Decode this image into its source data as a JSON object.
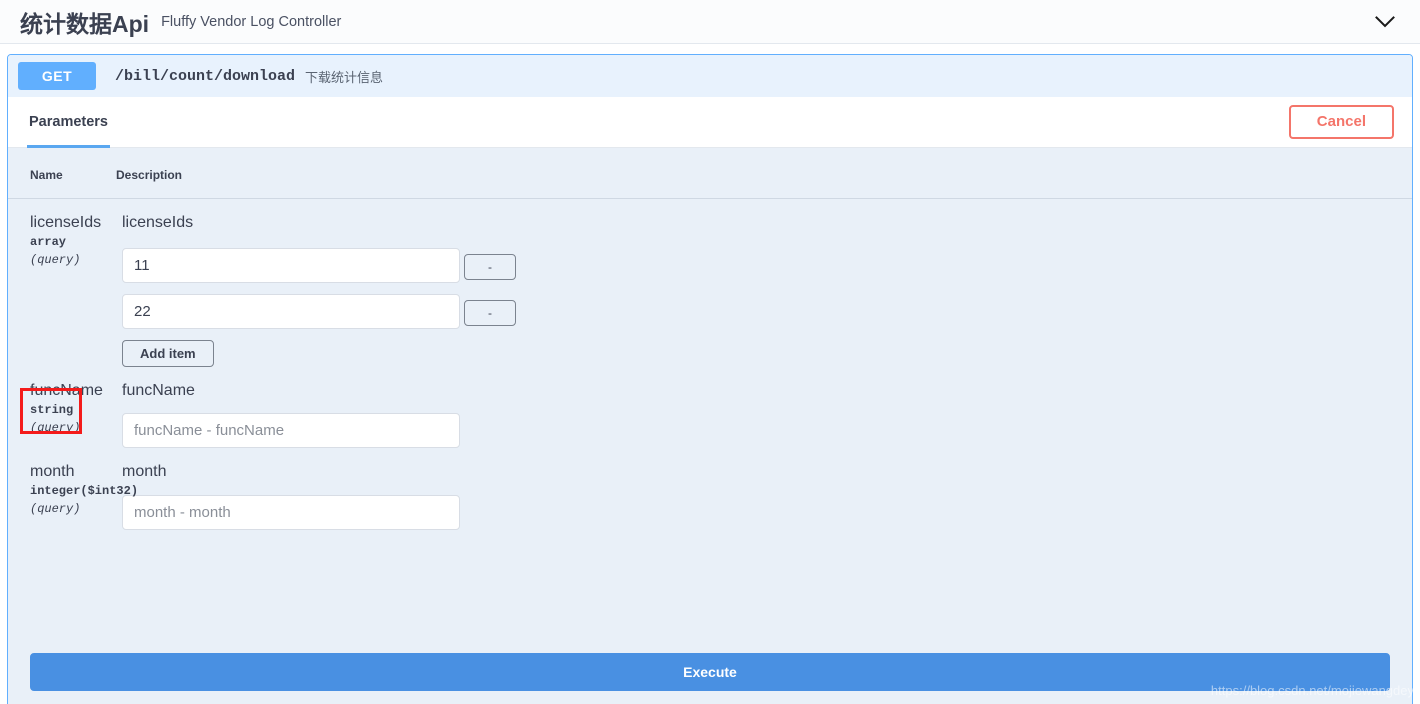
{
  "header": {
    "title": "统计数据Api",
    "subtitle": "Fluffy Vendor Log Controller",
    "collapse_icon": "chevron-down-icon"
  },
  "operation": {
    "method": "GET",
    "path": "/bill/count/download",
    "summary": "下载统计信息"
  },
  "tabs": [
    {
      "label": "Parameters",
      "active": true
    }
  ],
  "actions": {
    "cancel_label": "Cancel",
    "execute_label": "Execute"
  },
  "table": {
    "header_name": "Name",
    "header_description": "Description"
  },
  "parameters": [
    {
      "name": "licenseIds",
      "type": "array",
      "in": "(query)",
      "description": "licenseIds",
      "kind": "array",
      "items": [
        {
          "value": "11",
          "remove_label": "-"
        },
        {
          "value": "22",
          "remove_label": "-"
        }
      ],
      "add_item_label": "Add item",
      "annotated": true
    },
    {
      "name": "funcName",
      "type": "string",
      "in": "(query)",
      "description": "funcName",
      "kind": "text",
      "value": "",
      "placeholder": "funcName - funcName"
    },
    {
      "name": "month",
      "type": "integer($int32)",
      "in": "(query)",
      "description": "month",
      "kind": "text",
      "value": "",
      "placeholder": "month - month"
    }
  ],
  "watermark": "https://blog.csdn.net/mojiewangdey",
  "colors": {
    "method_blue": "#61affe",
    "execute_blue": "#4990e2",
    "cancel_red": "#f4756a",
    "annotation_red": "#f41b1b",
    "params_bg": "#e9f0f8"
  }
}
